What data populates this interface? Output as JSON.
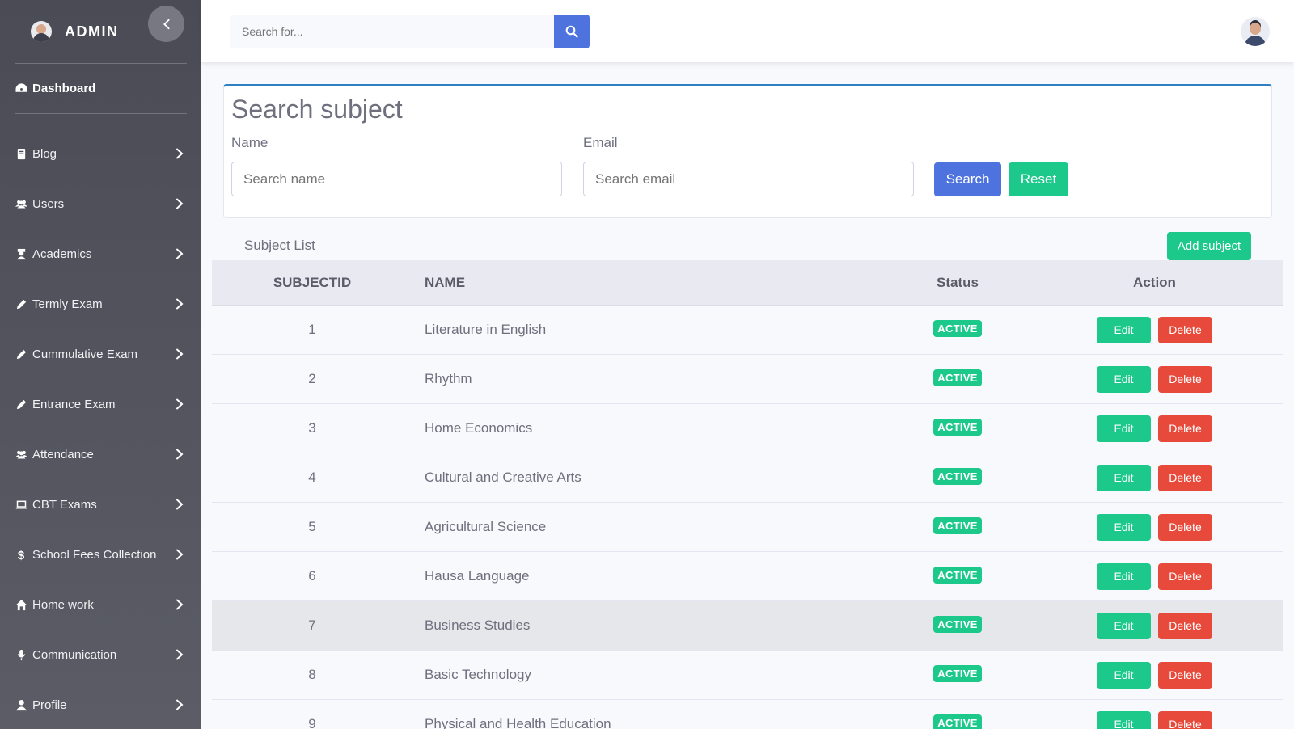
{
  "sidebar": {
    "brand": "ADMIN",
    "dashboard": "Dashboard",
    "items": [
      {
        "label": "Blog",
        "icon": "book-icon"
      },
      {
        "label": "Users",
        "icon": "users-icon"
      },
      {
        "label": "Academics",
        "icon": "graduate-icon"
      },
      {
        "label": "Termly Exam",
        "icon": "pencil-icon"
      },
      {
        "label": "Cummulative Exam",
        "icon": "pencil-icon"
      },
      {
        "label": "Entrance Exam",
        "icon": "pencil-icon"
      },
      {
        "label": "Attendance",
        "icon": "users-icon"
      },
      {
        "label": "CBT Exams",
        "icon": "laptop-icon"
      },
      {
        "label": "School Fees Collection",
        "icon": "dollar-icon"
      },
      {
        "label": "Home work",
        "icon": "home-icon"
      },
      {
        "label": "Communication",
        "icon": "microphone-icon"
      },
      {
        "label": "Profile",
        "icon": "user-icon"
      }
    ]
  },
  "topbar": {
    "search_placeholder": "Search for..."
  },
  "search_card": {
    "title": "Search subject",
    "name_label": "Name",
    "name_placeholder": "Search name",
    "email_label": "Email",
    "email_placeholder": "Search email",
    "search_btn": "Search",
    "reset_btn": "Reset"
  },
  "list": {
    "title": "Subject List",
    "add_btn": "Add subject",
    "columns": [
      "SUBJECTID",
      "NAME",
      "Status",
      "Action"
    ],
    "edit_label": "Edit",
    "delete_label": "Delete",
    "rows": [
      {
        "id": "1",
        "name": "Literature in English",
        "status": "ACTIVE"
      },
      {
        "id": "2",
        "name": "Rhythm",
        "status": "ACTIVE"
      },
      {
        "id": "3",
        "name": "Home Economics",
        "status": "ACTIVE"
      },
      {
        "id": "4",
        "name": "Cultural and Creative Arts",
        "status": "ACTIVE"
      },
      {
        "id": "5",
        "name": "Agricultural Science",
        "status": "ACTIVE"
      },
      {
        "id": "6",
        "name": "Hausa Language",
        "status": "ACTIVE"
      },
      {
        "id": "7",
        "name": "Business Studies",
        "status": "ACTIVE"
      },
      {
        "id": "8",
        "name": "Basic Technology",
        "status": "ACTIVE"
      },
      {
        "id": "9",
        "name": "Physical and Health Education",
        "status": "ACTIVE"
      }
    ]
  },
  "colors": {
    "primary": "#4e73df",
    "success": "#1cc88a",
    "danger": "#e74a3b",
    "sidebar": "#4a4b55",
    "card_accent": "#2f80c2"
  }
}
